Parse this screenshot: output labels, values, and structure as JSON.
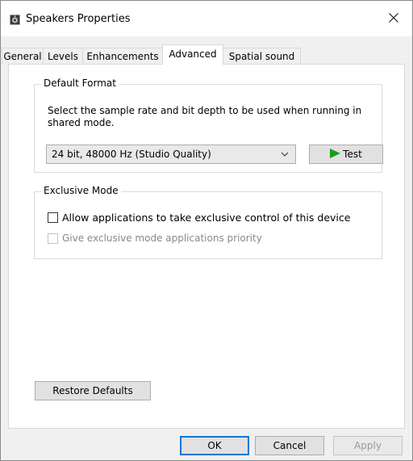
{
  "window": {
    "title": "Speakers Properties",
    "close_glyph": "✕"
  },
  "tabs": [
    {
      "label": "General"
    },
    {
      "label": "Levels"
    },
    {
      "label": "Enhancements"
    },
    {
      "label": "Advanced",
      "active": true
    },
    {
      "label": "Spatial sound"
    }
  ],
  "default_format": {
    "legend": "Default Format",
    "description": "Select the sample rate and bit depth to be used when running in shared mode.",
    "selected_format": "24 bit, 48000 Hz (Studio Quality)",
    "test_label": "Test"
  },
  "exclusive_mode": {
    "legend": "Exclusive Mode",
    "allow_label": "Allow applications to take exclusive control of this device",
    "allow_checked": false,
    "priority_label": "Give exclusive mode applications priority",
    "priority_checked": false,
    "priority_enabled": false
  },
  "restore_label": "Restore Defaults",
  "footer": {
    "ok": "OK",
    "cancel": "Cancel",
    "apply": "Apply"
  },
  "colors": {
    "accent": "#0078d7",
    "test_arrow": "#1a9c22"
  }
}
